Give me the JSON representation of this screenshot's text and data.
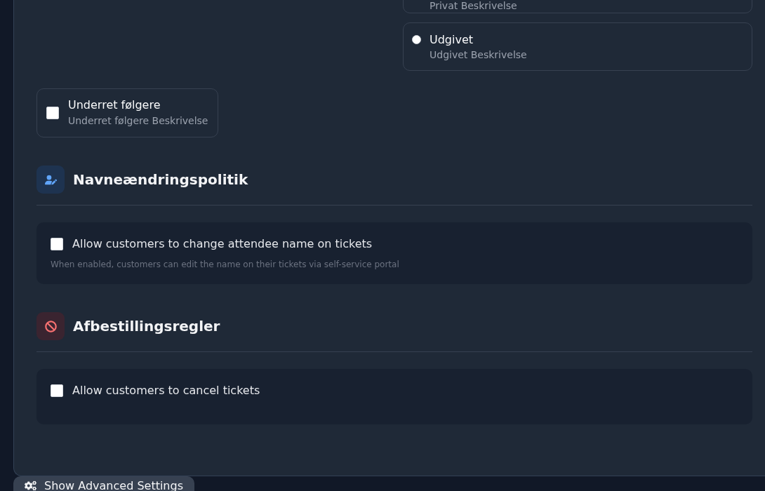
{
  "partial_option": {
    "description": "Privat Beskrivelse"
  },
  "visibility_options": [
    {
      "label": "Udgivet",
      "description": "Udgivet Beskrivelse",
      "selected": false
    }
  ],
  "notify_followers": {
    "label": "Underret følgere",
    "description": "Underret følgere Beskrivelse",
    "checked": false
  },
  "sections": [
    {
      "kind": "name_change",
      "title": "Navneændringspolitik",
      "option": {
        "label": "Allow customers to change attendee name on tickets",
        "help": "When enabled, customers can edit the name on their tickets via self-service portal",
        "checked": false
      }
    },
    {
      "kind": "cancellation",
      "title": "Afbestillingsregler",
      "option": {
        "label": "Allow customers to cancel tickets",
        "checked": false
      }
    }
  ],
  "advanced_button": {
    "label": "Show Advanced Settings"
  }
}
